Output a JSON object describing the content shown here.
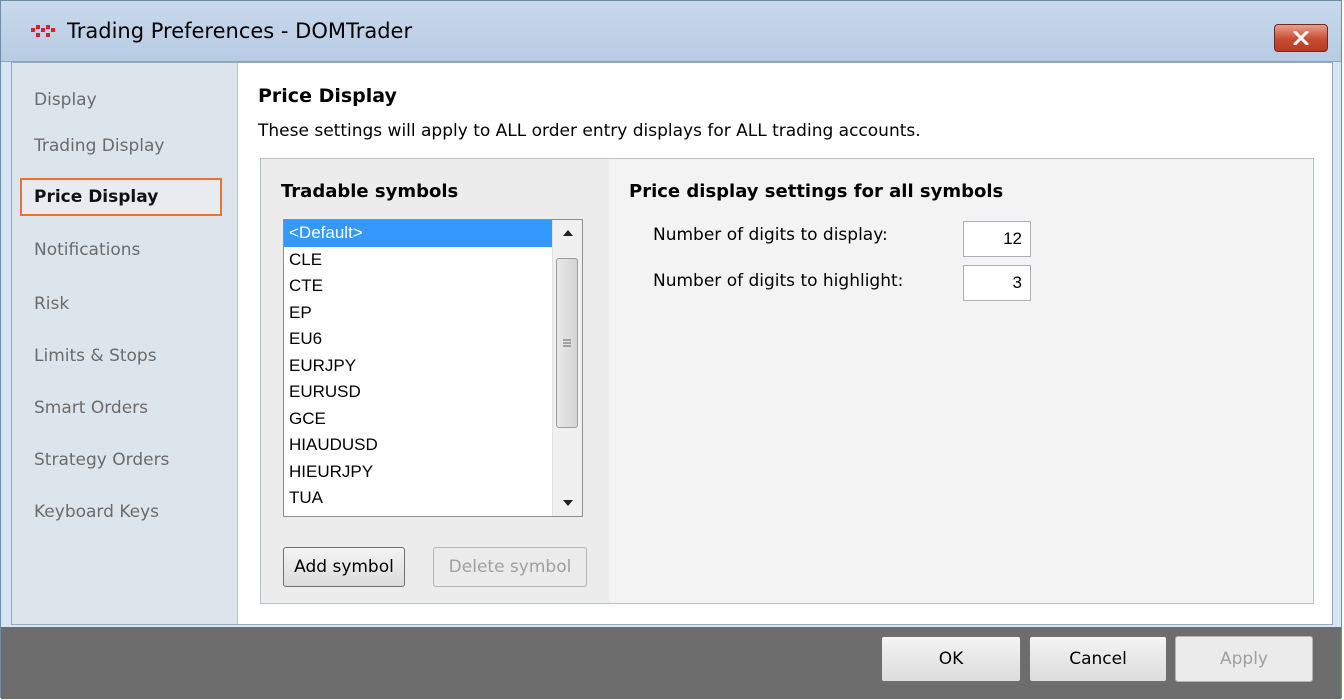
{
  "window": {
    "title": "Trading Preferences - DOMTrader"
  },
  "sidebar": {
    "items": [
      {
        "label": "Display"
      },
      {
        "label": "Trading Display"
      },
      {
        "label": "Price Display"
      },
      {
        "label": "Notifications"
      },
      {
        "label": "Risk"
      },
      {
        "label": "Limits & Stops"
      },
      {
        "label": "Smart Orders"
      },
      {
        "label": "Strategy Orders"
      },
      {
        "label": "Keyboard Keys"
      }
    ],
    "active": "Price Display"
  },
  "main": {
    "title": "Price Display",
    "description": "These settings will apply to ALL order entry displays for ALL trading accounts."
  },
  "symbols": {
    "heading": "Tradable symbols",
    "items": [
      "<Default>",
      "CLE",
      "CTE",
      "EP",
      "EU6",
      "EURJPY",
      "EURUSD",
      "GCE",
      "HIAUDUSD",
      "HIEURJPY",
      "TUA"
    ],
    "selected": "<Default>",
    "add_label": "Add symbol",
    "delete_label": "Delete symbol"
  },
  "settings": {
    "heading": "Price display settings for all symbols",
    "digits_display_label": "Number of digits to display:",
    "digits_display_value": "12",
    "digits_highlight_label": "Number of digits to highlight:",
    "digits_highlight_value": "3"
  },
  "footer": {
    "ok_label": "OK",
    "cancel_label": "Cancel",
    "apply_label": "Apply"
  },
  "colors": {
    "accent_selection": "#3399ff",
    "active_border": "#e8722f",
    "close_button": "#c84b31"
  }
}
